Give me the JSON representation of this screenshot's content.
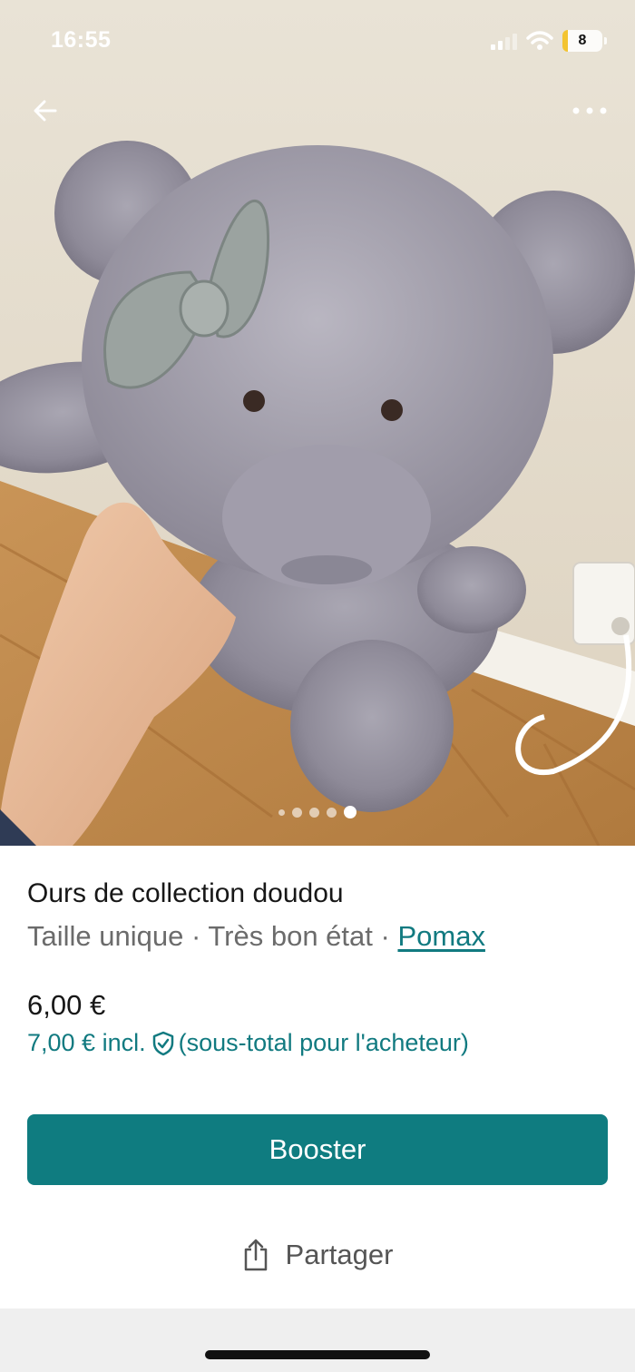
{
  "status_bar": {
    "time": "16:55",
    "battery_level": "8",
    "icons": [
      "signal-icon",
      "wifi-icon",
      "battery-icon"
    ]
  },
  "photo": {
    "nav": {
      "back_icon": "arrow-left-icon",
      "more_icon": "more-horizontal-icon"
    },
    "carousel": {
      "total": 5,
      "active_index": 4
    }
  },
  "listing": {
    "title": "Ours de collection doudou",
    "size": "Taille unique",
    "separator": "·",
    "condition": "Très bon état",
    "brand": "Pomax",
    "price": "6,00 €",
    "buyer_price": "7,00 € incl.",
    "buyer_note": "(sous-total pour l'acheteur)",
    "buyer_icon": "shield-check-icon"
  },
  "actions": {
    "booster_label": "Booster",
    "share_label": "Partager",
    "share_icon": "share-icon"
  },
  "colors": {
    "accent": "#0f7c80",
    "link": "#117a80",
    "muted_text": "#6b6b6b"
  }
}
